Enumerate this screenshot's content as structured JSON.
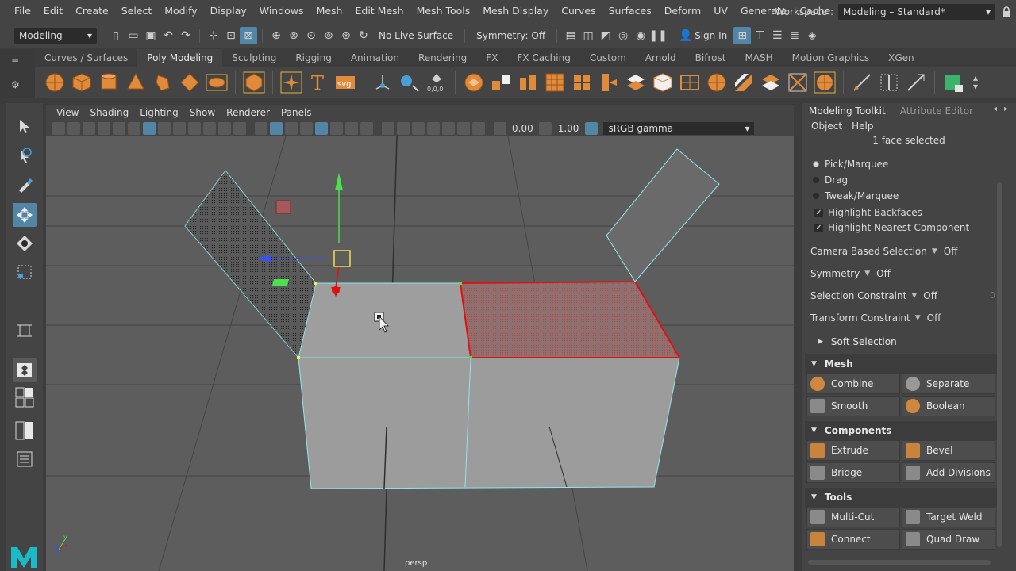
{
  "menubar": {
    "items": [
      "File",
      "Edit",
      "Create",
      "Select",
      "Modify",
      "Display",
      "Windows",
      "Mesh",
      "Edit Mesh",
      "Mesh Tools",
      "Mesh Display",
      "Curves",
      "Surfaces",
      "Deform",
      "UV",
      "Generate",
      "Cache"
    ],
    "workspace_label": "Workspace :",
    "workspace_value": "Modeling – Standard*"
  },
  "statusline": {
    "menuset": "Modeling",
    "live_surface": "No Live Surface",
    "symmetry": "Symmetry: Off",
    "sign_in": "Sign In"
  },
  "shelf": {
    "tabs": [
      "Curves / Surfaces",
      "Poly Modeling",
      "Sculpting",
      "Rigging",
      "Animation",
      "Rendering",
      "FX",
      "FX Caching",
      "Custom",
      "Arnold",
      "Bifrost",
      "MASH",
      "Motion Graphics",
      "XGen"
    ],
    "active_tab": "Poly Modeling"
  },
  "viewport": {
    "menus": [
      "View",
      "Shading",
      "Lighting",
      "Show",
      "Renderer",
      "Panels"
    ],
    "exposure": "0.00",
    "gamma": "1.00",
    "color_space": "sRGB gamma",
    "camera": "persp"
  },
  "panel": {
    "tabs": [
      "Modeling Toolkit",
      "Attribute Editor"
    ],
    "submenus": [
      "Object",
      "Help"
    ],
    "selection_info": "1 face selected",
    "pick_modes": [
      "Pick/Marquee",
      "Drag",
      "Tweak/Marquee"
    ],
    "checks": [
      "Highlight Backfaces",
      "Highlight Nearest Component"
    ],
    "options": [
      {
        "label": "Camera Based Selection",
        "value": "Off"
      },
      {
        "label": "Symmetry",
        "value": "Off"
      },
      {
        "label": "Selection Constraint",
        "value": "Off"
      },
      {
        "label": "Transform Constraint",
        "value": "Off"
      }
    ],
    "constraint_num": "0",
    "soft_selection": "Soft Selection",
    "sections": {
      "mesh": "Mesh",
      "components": "Components",
      "tools": "Tools"
    },
    "mesh_buttons": [
      "Combine",
      "Separate",
      "Smooth",
      "Boolean"
    ],
    "component_buttons": [
      "Extrude",
      "Bevel",
      "Bridge",
      "Add Divisions"
    ],
    "tool_buttons": [
      "Multi-Cut",
      "Target Weld",
      "Connect",
      "Quad Draw"
    ]
  },
  "colors": {
    "selection_red": "#e01010",
    "edge_cyan": "#8fe6f0",
    "accent_blue": "#5285a6",
    "shelf_orange": "#e08a3c"
  }
}
